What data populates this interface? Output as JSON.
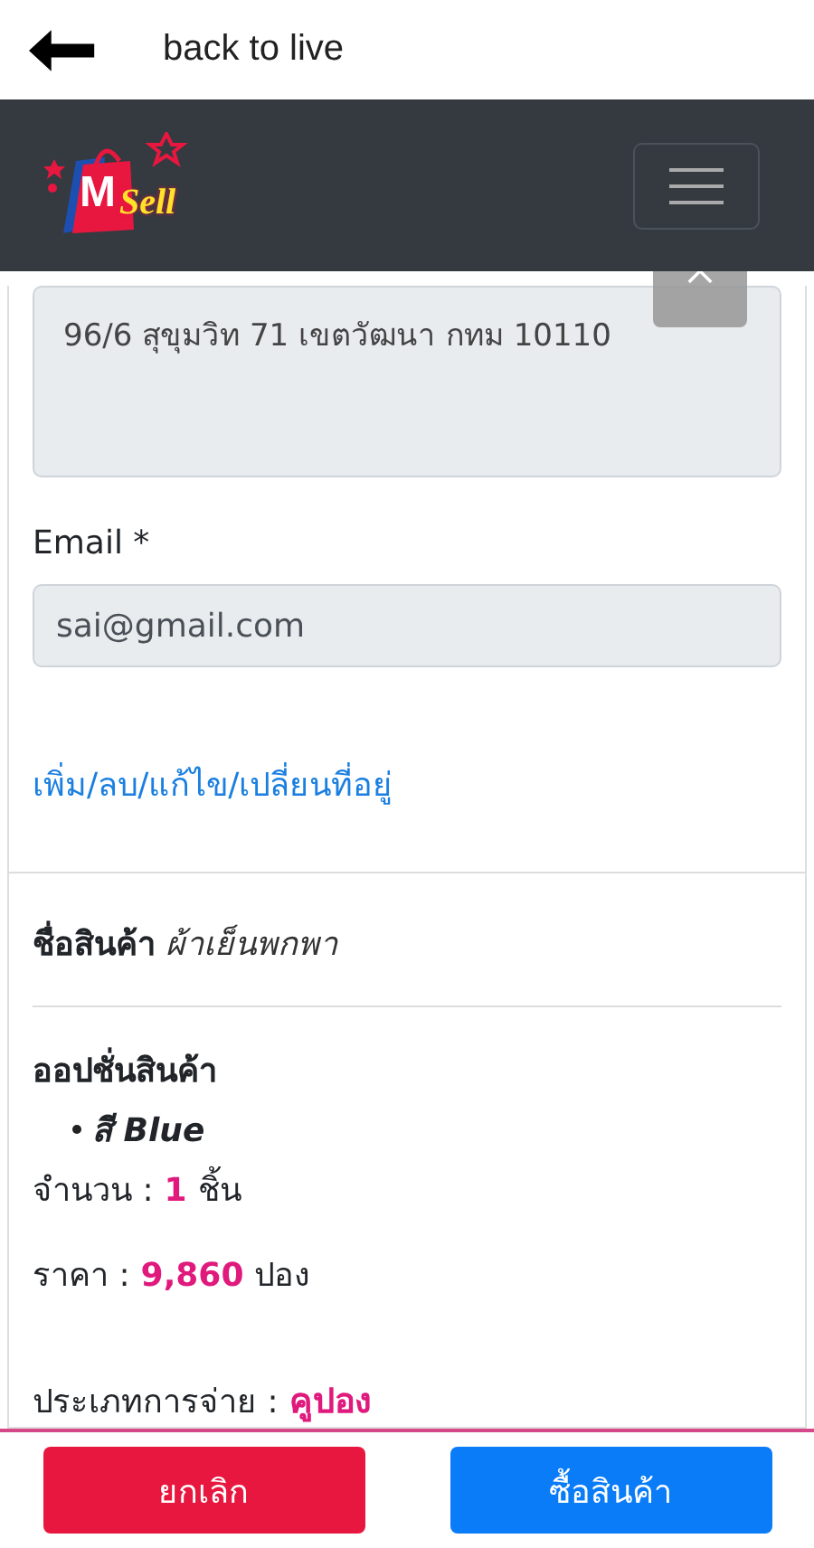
{
  "top_bar": {
    "title": "back to live"
  },
  "logo": {
    "letter": "M",
    "word": "Sell"
  },
  "address": {
    "value": "96/6 สุขุมวิท 71 เขตวัฒนา กทม 10110"
  },
  "email": {
    "label": "Email *",
    "value": "sai@gmail.com"
  },
  "address_link": "เพิ่ม/ลบ/แก้ไข/เปลี่ยนที่อยู่",
  "product": {
    "label": "ชื่อสินค้า",
    "value": "ผ้าเย็นพกพา"
  },
  "options": {
    "title": "ออปชั่นสินค้า",
    "items": [
      "สี Blue"
    ]
  },
  "details": [
    {
      "label": "จำนวน :",
      "value": "1",
      "unit": "ชิ้น"
    },
    {
      "label": "ราคา :",
      "value": "9,860",
      "unit": "ปอง"
    },
    {
      "label": "ประเภทการจ่าย :",
      "value": "คูปอง"
    }
  ],
  "buttons": [
    {
      "label": "ยกเลิก",
      "kind": "cancel"
    },
    {
      "label": "ซื้อสินค้า",
      "kind": "buy"
    }
  ]
}
